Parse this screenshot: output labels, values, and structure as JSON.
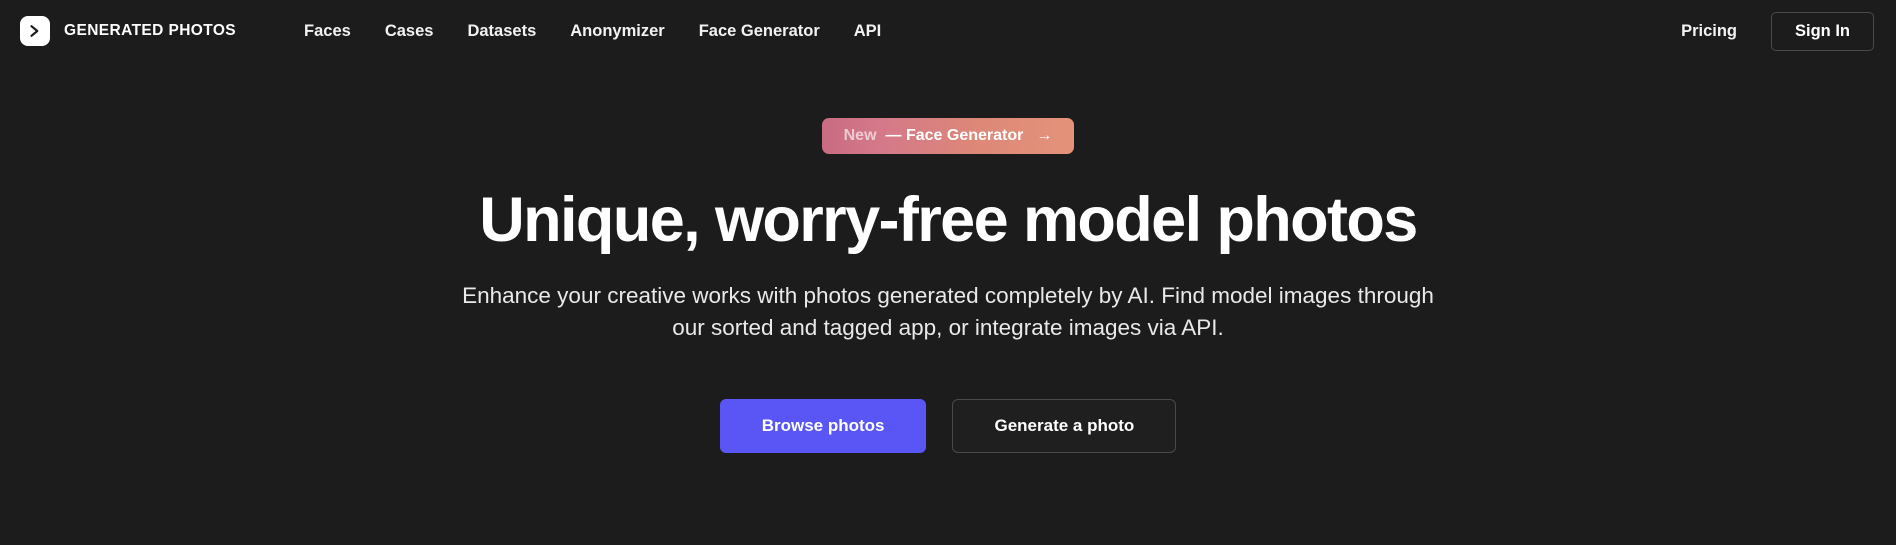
{
  "brand": {
    "name": "GENERATED PHOTOS",
    "logo_icon": "chevron-right-logo-icon"
  },
  "nav": {
    "items": [
      {
        "label": "Faces"
      },
      {
        "label": "Cases"
      },
      {
        "label": "Datasets"
      },
      {
        "label": "Anonymizer"
      },
      {
        "label": "Face Generator"
      },
      {
        "label": "API"
      }
    ],
    "pricing_label": "Pricing",
    "signin_label": "Sign In"
  },
  "hero": {
    "badge": {
      "new_label": "New",
      "text": "— Face Generator",
      "arrow_icon": "arrow-right-icon",
      "gradient_start": "#c96b81",
      "gradient_end": "#e4937a"
    },
    "headline": "Unique, worry-free model photos",
    "subtitle": "Enhance your creative works with photos generated completely by AI. Find model images through our sorted and tagged app, or integrate images via API.",
    "primary_cta": "Browse photos",
    "secondary_cta": "Generate a photo"
  },
  "colors": {
    "background": "#1c1c1c",
    "primary_button": "#5956f5",
    "border": "#4a4a4a",
    "text": "#ffffff"
  }
}
